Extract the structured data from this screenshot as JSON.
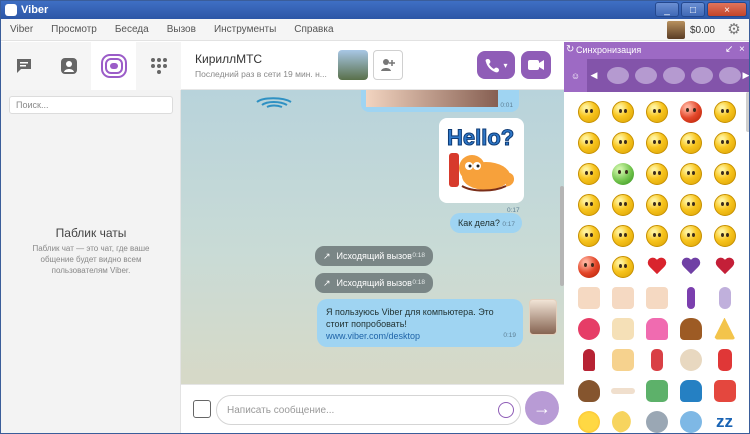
{
  "window": {
    "title": "Viber"
  },
  "menu": {
    "items": [
      "Viber",
      "Просмотр",
      "Беседа",
      "Вызов",
      "Инструменты",
      "Справка"
    ]
  },
  "account": {
    "balance": "$0.00"
  },
  "nav": {
    "items": [
      "chat-icon",
      "contacts-icon",
      "public-chats-icon",
      "dialpad-icon"
    ],
    "active": "public-chats-icon"
  },
  "search": {
    "placeholder": "Поиск..."
  },
  "public_chats": {
    "title": "Паблик чаты",
    "description": "Паблик чат — это чат, где ваше общение будет видно всем пользователям Viber."
  },
  "conversation": {
    "contact_name": "КириллМТС",
    "status": "Последний раз в сети 19 мин. н...",
    "messages": {
      "image_time": "0:01",
      "sticker_time": "0:17",
      "text1": {
        "text": "Как дела?",
        "time": "0:17"
      },
      "call1": {
        "text": "Исходящий вызов",
        "time": "0:18"
      },
      "call2": {
        "text": "Исходящий вызов",
        "time": "0:18"
      },
      "text2": {
        "text": "Я пользуюсь Viber для компьютера. Это стоит попробовать!",
        "link": "www.viber.com/desktop",
        "time": "0:19"
      }
    }
  },
  "composer": {
    "placeholder": "Написать сообщение..."
  },
  "sticker_panel": {
    "header": "Синхронизация",
    "colors": {
      "accent": "#9d6ac4",
      "accent_dark": "#8354aa"
    }
  }
}
